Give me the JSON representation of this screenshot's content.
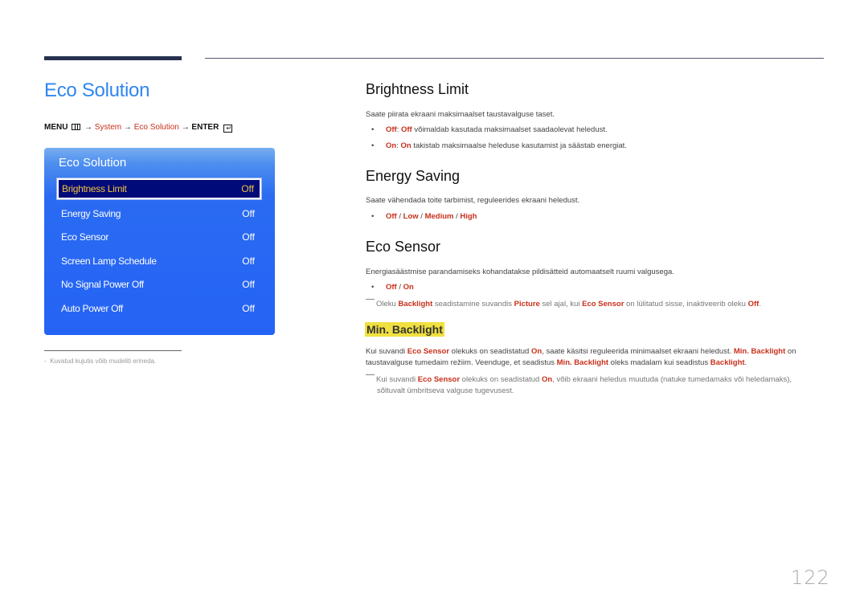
{
  "page": {
    "title": "Eco Solution",
    "page_number": "122"
  },
  "menu_path": {
    "menu": "MENU",
    "arrow": "→",
    "system": "System",
    "eco_solution": "Eco Solution",
    "enter": "ENTER",
    "menu_icon": "menu-grid-icon",
    "enter_icon": "enter-icon"
  },
  "osd": {
    "title": "Eco Solution",
    "items": [
      {
        "label": "Brightness Limit",
        "value": "Off",
        "selected": true
      },
      {
        "label": "Energy Saving",
        "value": "Off"
      },
      {
        "label": "Eco Sensor",
        "value": "Off"
      },
      {
        "label": "Screen Lamp Schedule",
        "value": "Off"
      },
      {
        "label": "No Signal Power Off",
        "value": "Off"
      },
      {
        "label": "Auto Power Off",
        "value": "Off"
      }
    ]
  },
  "footnote": "Kuvatud kujutis võib mudeliti erineda.",
  "sections": {
    "brightness_limit": {
      "heading": "Brightness Limit",
      "desc": "Saate piirata ekraani maksimaalset taustavalguse taset.",
      "bullets": [
        {
          "k1": "Off",
          "sep": ": ",
          "k2": "Off",
          "text": " võimaldab kasutada maksimaalset saadaolevat heledust."
        },
        {
          "k1": "On",
          "sep": ": ",
          "k2": "On",
          "text": " takistab maksimaalse heleduse kasutamist ja säästab energiat."
        }
      ]
    },
    "energy_saving": {
      "heading": "Energy Saving",
      "desc": "Saate vähendada toite tarbimist, reguleerides ekraani heledust.",
      "options": [
        "Off",
        "Low",
        "Medium",
        "High"
      ],
      "sep": " / "
    },
    "eco_sensor": {
      "heading": "Eco Sensor",
      "desc": "Energiasäästmise parandamiseks kohandatakse pildisätteid automaatselt ruumi valgusega.",
      "options": [
        "Off",
        "On"
      ],
      "sep": " / ",
      "note": {
        "t1": "Oleku ",
        "k1": "Backlight",
        "t2": " seadistamine suvandis ",
        "k2": "Picture",
        "t3": " sel ajal, kui ",
        "k3": "Eco Sensor",
        "t4": " on lülitatud sisse, inaktiveerib oleku ",
        "k4": "Off",
        "t5": "."
      }
    },
    "min_backlight": {
      "heading": "Min. Backlight",
      "para": {
        "t1": "Kui suvandi ",
        "k1": "Eco Sensor",
        "t2": " olekuks on seadistatud ",
        "k2": "On",
        "t3": ", saate käsitsi reguleerida minimaalset ekraani heledust. ",
        "k3": "Min. Backlight",
        "t4": " on",
        "t5": "taustavalguse tumedaim režiim. Veenduge, et seadistus ",
        "k4": "Min. Backlight",
        "t6": " oleks madalam kui seadistus ",
        "k5": "Backlight",
        "t7": "."
      },
      "note": {
        "t1": "Kui suvandi ",
        "k1": "Eco Sensor",
        "t2": " olekuks on seadistatud ",
        "k2": "On",
        "t3": ", võib ekraani heledus muutuda (natuke tumedamaks või heledamaks),",
        "t4": "sõltuvalt ümbritseva valguse tugevusest."
      }
    }
  },
  "colors": {
    "title_blue": "#2f86f0",
    "keyword_red": "#c8301b",
    "osd_blue": "#2563f5",
    "osd_selected": "#000a78",
    "osd_selected_text": "#f0c040",
    "highlight_yellow": "#f0e040"
  }
}
